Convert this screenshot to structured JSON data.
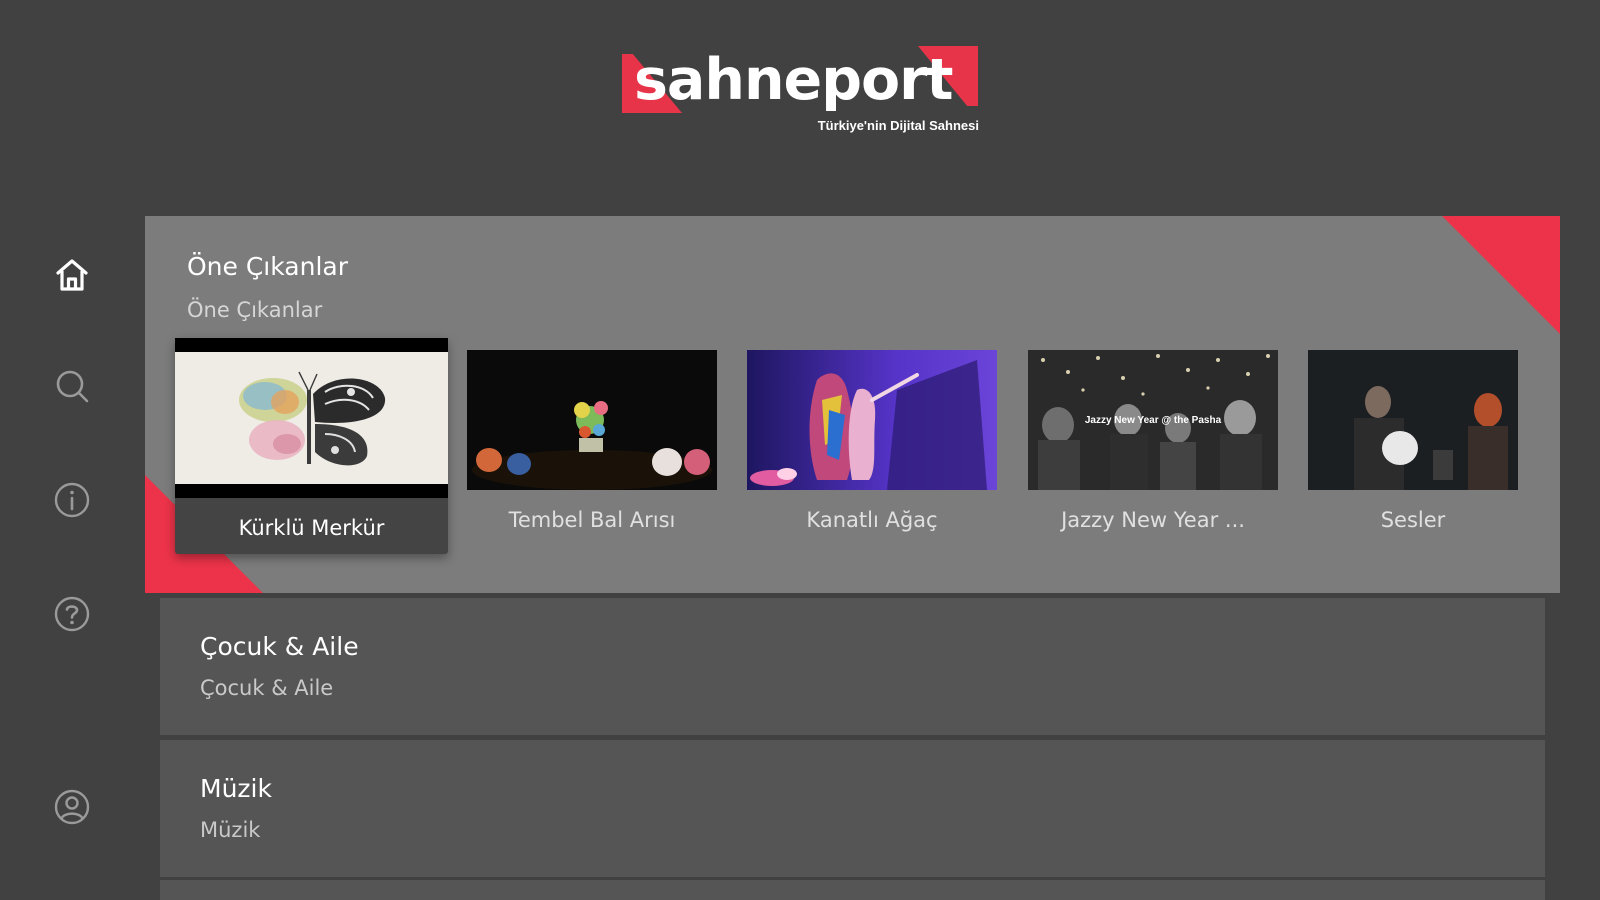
{
  "brand": {
    "name": "sahneport",
    "tagline": "Türkiye'nin Dijital Sahnesi",
    "accent_color": "#e83449"
  },
  "sidebar": {
    "items": [
      {
        "name": "home",
        "icon": "home-icon",
        "active": true
      },
      {
        "name": "search",
        "icon": "search-icon",
        "active": false
      },
      {
        "name": "info",
        "icon": "info-icon",
        "active": false
      },
      {
        "name": "help",
        "icon": "help-icon",
        "active": false
      },
      {
        "name": "profile",
        "icon": "user-icon",
        "active": false
      }
    ]
  },
  "rows": {
    "featured": {
      "title": "Öne Çıkanlar",
      "subtitle": "Öne Çıkanlar",
      "items": [
        {
          "title": "Kürklü Merkür",
          "focused": true
        },
        {
          "title": "Tembel Bal Arısı",
          "focused": false
        },
        {
          "title": "Kanatlı Ağaç",
          "focused": false
        },
        {
          "title": "Jazzy New Year ...",
          "focused": false,
          "thumb_caption": "Jazzy New Year @ the Pasha"
        },
        {
          "title": "Sesler",
          "focused": false
        }
      ]
    },
    "kids": {
      "title": "Çocuk & Aile",
      "subtitle": "Çocuk & Aile"
    },
    "music": {
      "title": "Müzik",
      "subtitle": "Müzik"
    }
  },
  "colors": {
    "background": "#414141",
    "featured_row": "#7c7c7c",
    "plain_row": "#555555",
    "focused_card": "#444444"
  }
}
